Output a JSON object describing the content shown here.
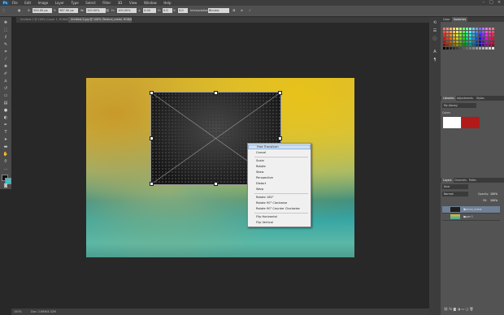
{
  "app": {
    "logo": "Ps"
  },
  "menu": [
    "File",
    "Edit",
    "Image",
    "Layer",
    "Type",
    "Select",
    "Filter",
    "3D",
    "View",
    "Window",
    "Help"
  ],
  "window_controls": {
    "minimize": "–",
    "maximize": "□",
    "close": "×"
  },
  "options_bar": {
    "x": "500.00 px",
    "y": "367.00 px",
    "w": "100.00%",
    "h": "100.00%",
    "angle": "0.00",
    "h_skew": "0.0",
    "v_skew": "0.0",
    "interpolation": "Bicubic"
  },
  "tabs": [
    {
      "label": "Untitled-1 @ 100% (Layer 1, RGB/8)"
    },
    {
      "label": "Untitled-2.jpg @ 100% (Texture_metal, RGB/8)"
    }
  ],
  "context_menu": {
    "items": [
      "Free Transform",
      "Cancel",
      "Scale",
      "Rotate",
      "Skew",
      "Perspective",
      "Distort",
      "Warp",
      "Rotate 180°",
      "Rotate 90° Clockwise",
      "Rotate 90° Counter Clockwise",
      "Flip Horizontal",
      "Flip Vertical"
    ],
    "highlighted": "Free Transform"
  },
  "status": {
    "zoom": "100%",
    "doc": "Doc: 2.89M/4.32M"
  },
  "panels": {
    "color_tabs": [
      "Color",
      "Swatches"
    ],
    "adjust_tabs": [
      "Libraries",
      "Adjustments",
      "Styles"
    ],
    "library_name": "My Library",
    "colors_label": "Colors",
    "layers_tabs": [
      "Layers",
      "Channels",
      "Paths"
    ],
    "blend_mode": "Normal",
    "opacity_label": "Opacity:",
    "opacity": "100%",
    "fill_label": "Fill:",
    "fill": "100%",
    "layers": [
      {
        "name": "Texture_metal",
        "selected": true
      },
      {
        "name": "Layer 1",
        "selected": false
      }
    ]
  },
  "colors": {
    "swatch_white": "#ffffff",
    "swatch_red": "#b21a1a"
  }
}
